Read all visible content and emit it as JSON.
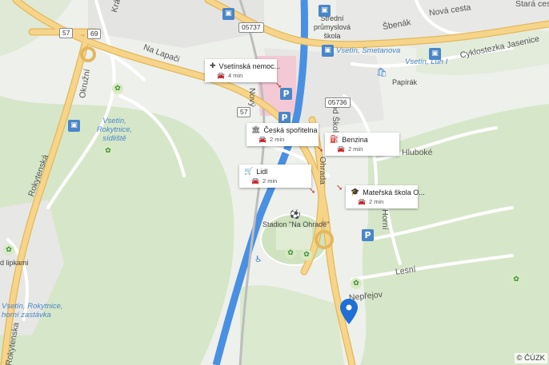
{
  "map": {
    "attribution": "© ČÚZK",
    "colors": {
      "land": "#eef0ec",
      "forest": "#d6e7c9",
      "water": "#4a90e2",
      "road_major": "#f6d58a",
      "road_minor": "#ffffff",
      "hospital": "#f4c9d6",
      "pin": "#1f6fd6"
    }
  },
  "labels": {
    "krasna": "Krásná",
    "na_lapaci": "Na Lapači",
    "okruzni": "Okružní",
    "rokytnice_sidliste": "Vsetín, Rokytnice, sídliště",
    "rokytenska": "Rokytenská",
    "rokytnice_horni": "Vsetín, Rokytnice, horní zastávka",
    "lipkami": "d lipkami",
    "rokytenska2": "Rokytenska",
    "stredni_skola": "Střední průmyslová škola",
    "sbenak": "Šbenák",
    "nova_cesta": "Nová cesta",
    "stara_cesta": "Stará ces",
    "smetanova": "Vsetín, Smetanova",
    "luh": "Vsetín, Luh I",
    "cyklostezka": "Cyklostezka Jasenice",
    "papirak": "Papírák",
    "pod_skolou": "Pod Školou",
    "ohrada": "Ohrada",
    "hluboke": "Hluboké",
    "horni": "Horní",
    "lesni": "Lesní",
    "neprejov": "Nepřejov",
    "stadion": "Stadion \"Na Ohradě\"",
    "novy": "Nový"
  },
  "shields": {
    "r57a": "57",
    "r69": "69",
    "r05737": "05737",
    "r57b": "57",
    "r05736": "05736"
  },
  "cards": [
    {
      "icon": "hospital-icon",
      "glyph": "✚",
      "name": "Vsetínská nemoc...",
      "time": "4 min"
    },
    {
      "icon": "bank-icon",
      "glyph": "🏛",
      "name": "Česká spořitelna",
      "time": "2 min"
    },
    {
      "icon": "fuel-icon",
      "glyph": "⛽",
      "name": "Benzina",
      "time": "2 min"
    },
    {
      "icon": "shopping-cart-icon",
      "glyph": "🛒",
      "name": "Lidl",
      "time": "2 min"
    },
    {
      "icon": "school-icon",
      "glyph": "🎓",
      "name": "Mateřská škola O...",
      "time": "2 min"
    }
  ],
  "pois": {
    "bus": "⬛",
    "parking": "P",
    "green": "✿"
  }
}
